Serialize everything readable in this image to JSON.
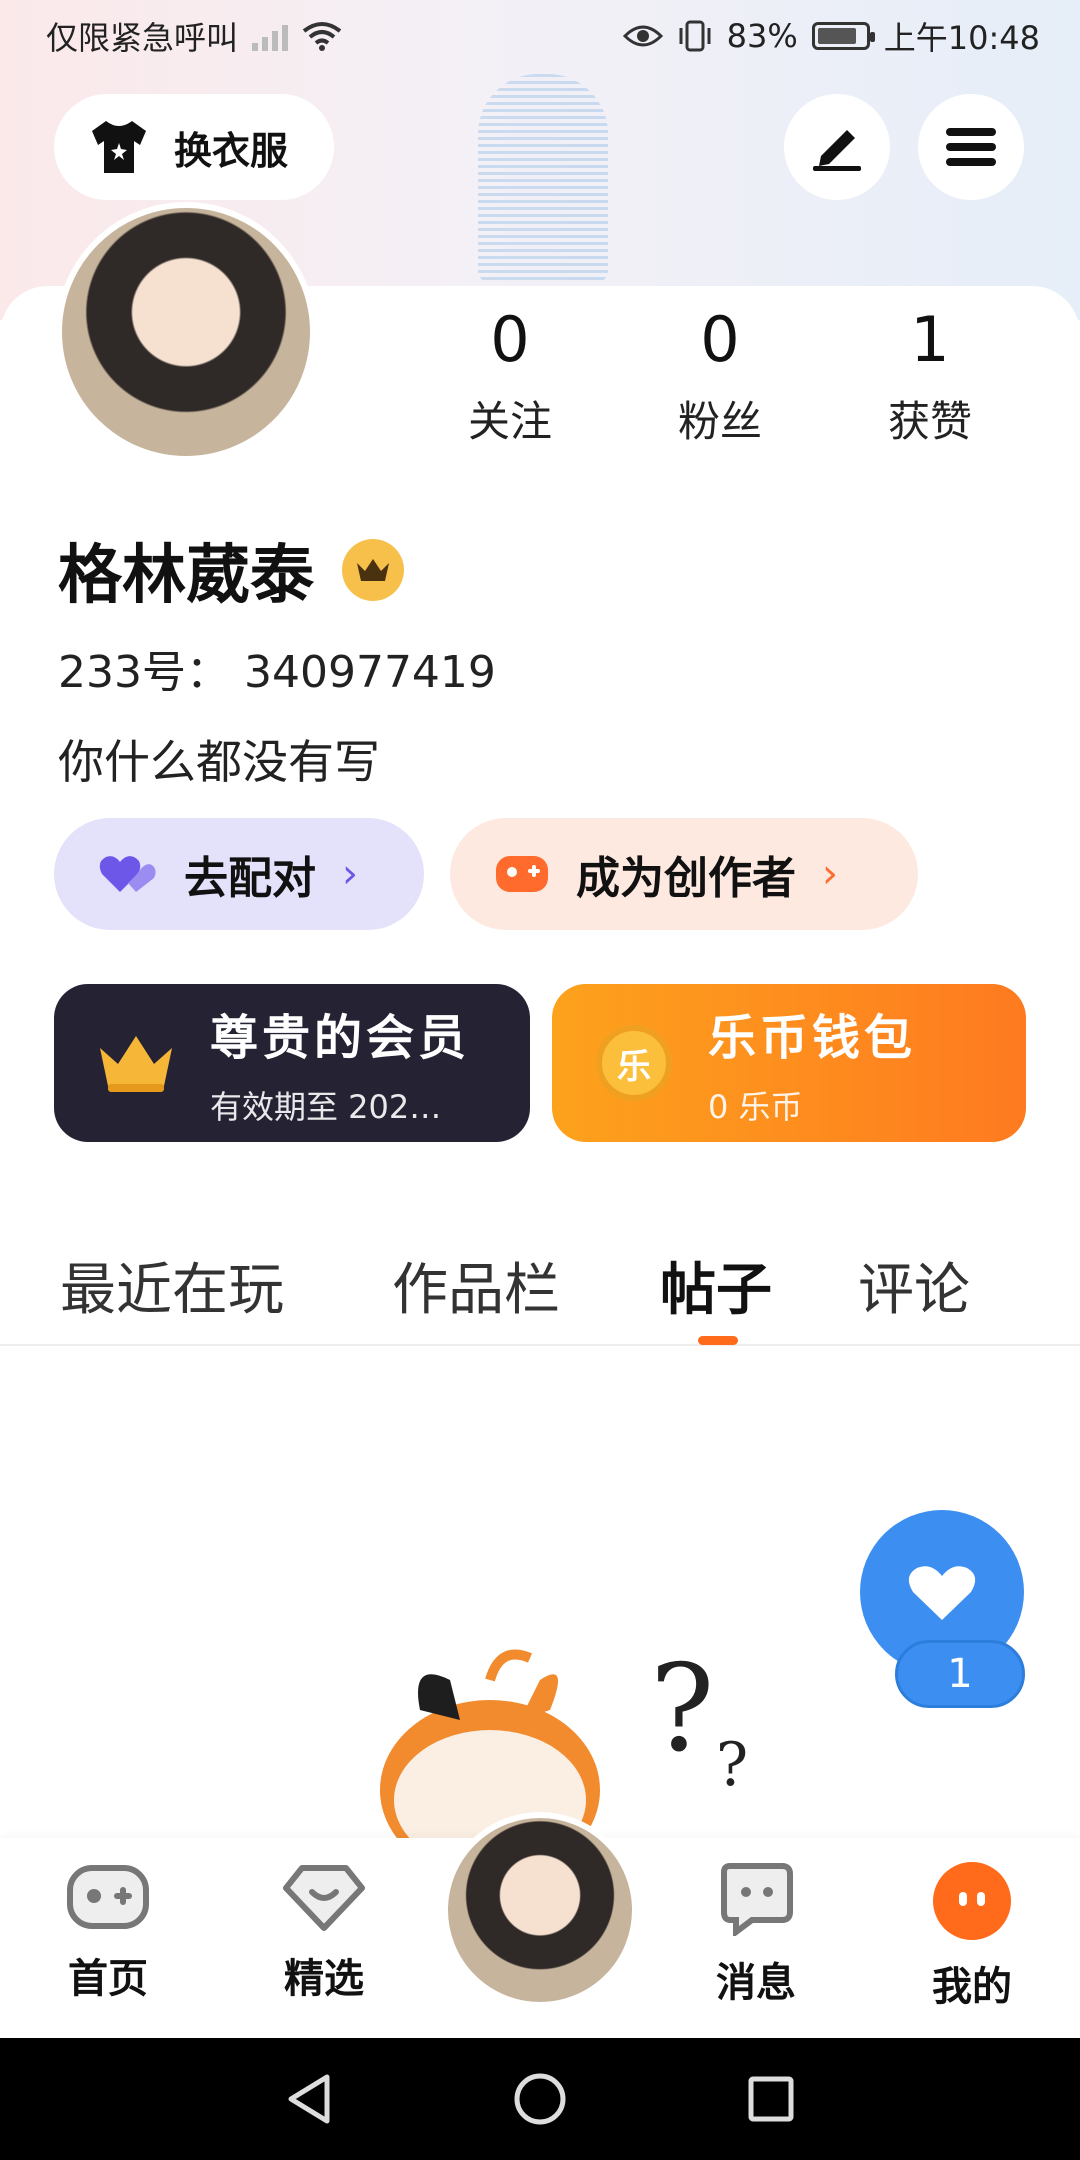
{
  "status_bar": {
    "left_text": "仅限紧急呼叫",
    "battery": "83%",
    "time": "上午10:48"
  },
  "header": {
    "outfit_button": "换衣服",
    "edit_icon": "pen-icon",
    "menu_icon": "hamburger-icon"
  },
  "stats": [
    {
      "value": "0",
      "label": "关注"
    },
    {
      "value": "0",
      "label": "粉丝"
    },
    {
      "value": "1",
      "label": "获赞"
    }
  ],
  "profile": {
    "name": "格林葳泰",
    "id_line": "233号： 340977419",
    "bio": "你什么都没有写"
  },
  "actions": {
    "pair_label": "去配对",
    "creator_label": "成为创作者"
  },
  "cards": {
    "vip_title": "尊贵的会员",
    "vip_sub": "有效期至 202…",
    "wallet_title": "乐币钱包",
    "wallet_sub": "0 乐币",
    "coin_symbol": "乐"
  },
  "tabs": [
    "最近在玩",
    "作品栏",
    "帖子",
    "评论"
  ],
  "active_tab": "帖子",
  "like_badge": "1",
  "bottom_nav": [
    "首页",
    "精选",
    "消息",
    "我的"
  ],
  "colors": {
    "accent": "#ff6b1a",
    "fab": "#3c8ef1",
    "vip_card": "#252234",
    "pair_pill": "#e4e2fb",
    "creator_pill": "#fde9e0"
  }
}
